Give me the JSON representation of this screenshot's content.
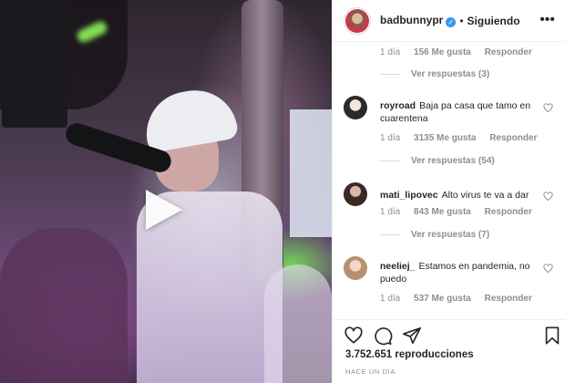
{
  "header": {
    "username": "badbunnypr",
    "separator": "•",
    "follow_label": "Siguiendo",
    "more_icon": "more-horizontal-icon"
  },
  "first_comment_meta": {
    "time": "1 día",
    "likes": "156 Me gusta",
    "reply": "Responder",
    "view_replies": "Ver respuestas (3)"
  },
  "comments": [
    {
      "username": "royroad",
      "text": "Baja pa casa que tamo en cuarentena",
      "time": "1 día",
      "likes": "3135 Me gusta",
      "reply": "Responder",
      "view_replies": "Ver respuestas (54)"
    },
    {
      "username": "mati_lipovec",
      "text": "Alto virus te va a dar",
      "time": "1 día",
      "likes": "843 Me gusta",
      "reply": "Responder",
      "view_replies": "Ver respuestas (7)"
    },
    {
      "username": "neeliej_",
      "text": "Estamos en pandemia, no puedo",
      "time": "1 día",
      "likes": "537 Me gusta",
      "reply": "Responder"
    }
  ],
  "actions": {
    "like_icon": "heart-icon",
    "comment_icon": "comment-icon",
    "share_icon": "send-icon",
    "save_icon": "bookmark-icon"
  },
  "views": "3.752.651 reproducciones",
  "posted": "HACE UN DÍA",
  "colors": {
    "verified": "#3897f0",
    "text": "#262626",
    "secondary": "#8e8e8e",
    "border": "#efefef"
  }
}
